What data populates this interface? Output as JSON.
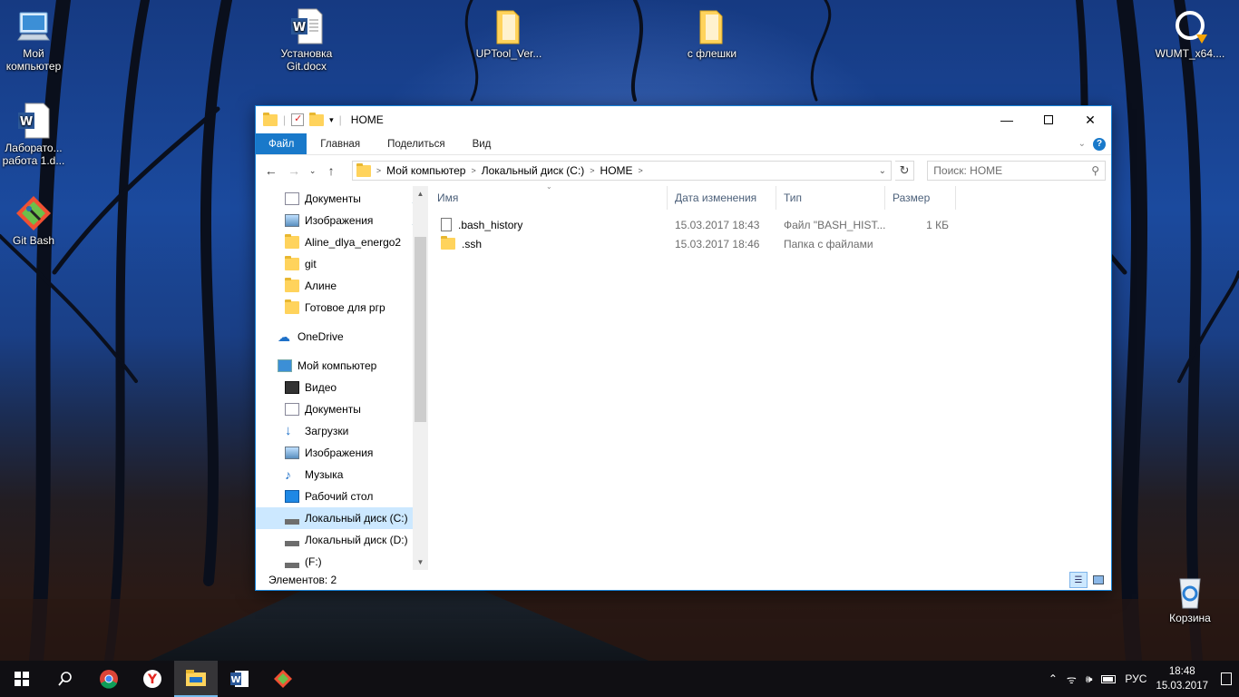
{
  "desktop": {
    "icons": [
      {
        "label": "Мой\nкомпьютер",
        "label1": "Мой",
        "label2": "компьютер"
      },
      {
        "label1": "Установка",
        "label2": "Git.docx"
      },
      {
        "label1": "UPTool_Ver...",
        "label2": ""
      },
      {
        "label1": "с флешки",
        "label2": ""
      },
      {
        "label1": "WUMT_x64....",
        "label2": ""
      },
      {
        "label1": "Лаборато...",
        "label2": "работа 1.d..."
      },
      {
        "label1": "Git Bash",
        "label2": ""
      },
      {
        "label1": "Корзина",
        "label2": ""
      }
    ]
  },
  "window": {
    "title": "HOME",
    "ribbon": {
      "file": "Файл",
      "home": "Главная",
      "share": "Поделиться",
      "view": "Вид"
    },
    "address": {
      "crumbs": [
        "Мой компьютер",
        "Локальный диск (C:)",
        "HOME"
      ]
    },
    "search_placeholder": "Поиск: HOME",
    "nav": [
      {
        "label": "Документы",
        "pinned": true
      },
      {
        "label": "Изображения",
        "pinned": true
      },
      {
        "label": "Aline_dlya_energo2"
      },
      {
        "label": "git"
      },
      {
        "label": "Алине"
      },
      {
        "label": "Готовое для ргр"
      },
      {
        "label": "OneDrive"
      },
      {
        "label": "Мой компьютер"
      },
      {
        "label": "Видео"
      },
      {
        "label": "Документы"
      },
      {
        "label": "Загрузки"
      },
      {
        "label": "Изображения"
      },
      {
        "label": "Музыка"
      },
      {
        "label": "Рабочий стол"
      },
      {
        "label": "Локальный диск (C:)"
      },
      {
        "label": "Локальный диск (D:)"
      },
      {
        "label": " (F:)"
      }
    ],
    "columns": {
      "name": "Имя",
      "date": "Дата изменения",
      "type": "Тип",
      "size": "Размер"
    },
    "files": [
      {
        "name": ".bash_history",
        "date": "15.03.2017 18:43",
        "type": "Файл \"BASH_HIST...",
        "size": "1 КБ"
      },
      {
        "name": ".ssh",
        "date": "15.03.2017 18:46",
        "type": "Папка с файлами",
        "size": ""
      }
    ],
    "status": "Элементов: 2"
  },
  "taskbar": {
    "lang": "РУС",
    "time": "18:48",
    "date": "15.03.2017"
  }
}
